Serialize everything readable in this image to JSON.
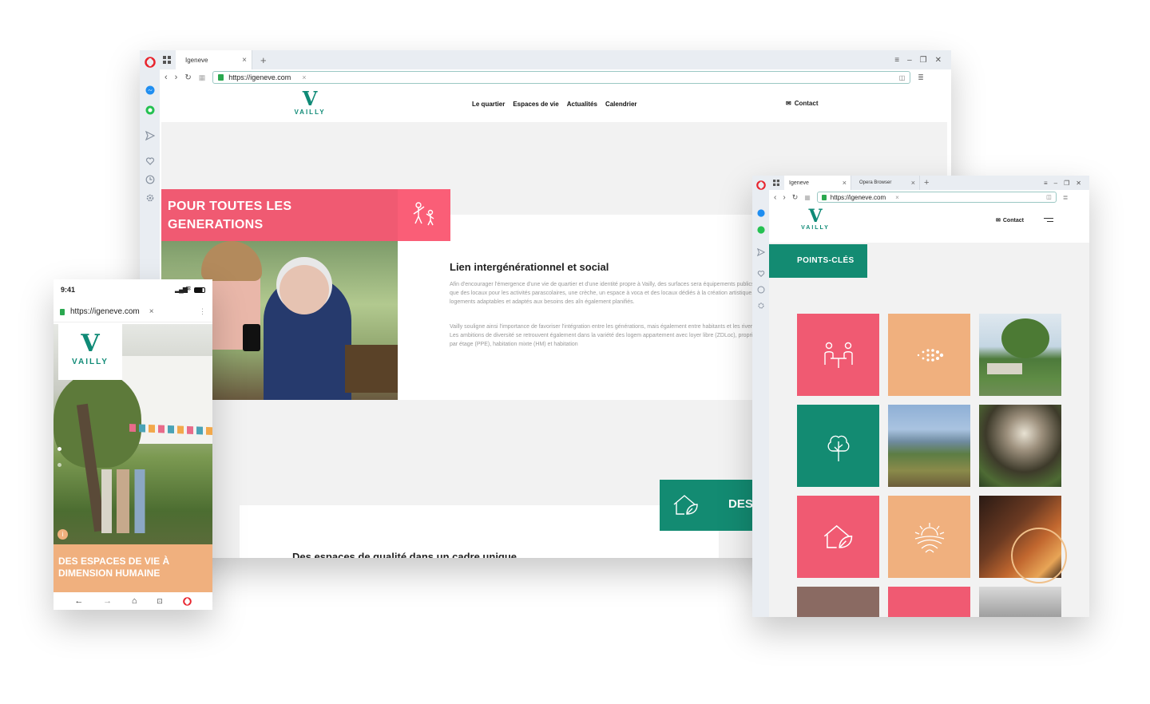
{
  "desktop": {
    "tab_title": "Igeneve",
    "url": "https://igeneve.com",
    "logo_text": "VAILLY",
    "nav": [
      "Le quartier",
      "Espaces de vie",
      "Actualités",
      "Calendrier"
    ],
    "contact": "Contact",
    "gen_banner": "POUR TOUTES LES GENERATIONS",
    "section_title": "Lien intergénérationnel et social",
    "paragraph1": "Afin d'encourager l'émergence d'une vie de quartier et d'une identité propre à Vailly, des surfaces sera équipements publics tels que des locaux pour les activités parascolaires, une crèche, un espace à voca et des locaux dédiés à la création artistique. Des logements adaptables et adaptés aux besoins des aîn également planifiés.",
    "paragraph2": "Vailly souligne ainsi l'importance de favoriser l'intégration entre les générations, mais également entre habitants et les riverains. Les ambitions de diversité se retrouvent également dans la variété des logem appartement avec loyer libre (ZDLoc), propriété par étage (PPE), habitation mixte (HM) et habitation",
    "des_label": "DES",
    "bottom_heading": "Des espaces de qualité dans un cadre unique"
  },
  "tablet": {
    "tab_title": "Igeneve",
    "tab2_title": "Opera Browser",
    "url": "https://igeneve.com",
    "logo_text": "VAILLY",
    "contact": "Contact",
    "banner": "POINTS-CLÉS"
  },
  "mobile": {
    "time": "9:41",
    "url": "https://igeneve.com",
    "logo_text": "VAILLY",
    "hero_text": "DES ESPACES DE VIE À DIMENSION HUMAINE"
  },
  "colors": {
    "teal": "#138b72",
    "pink": "#f05a72",
    "peach": "#f0b07e",
    "opera_red": "#e8242d"
  },
  "icons": [
    "opera-icon",
    "messenger-icon",
    "whatsapp-icon",
    "send-icon",
    "heart-icon",
    "history-icon",
    "settings-icon",
    "family-icon",
    "people-table-icon",
    "dots-icon",
    "tree-icon",
    "house-leaf-icon",
    "sunrise-icon",
    "envelope-icon",
    "menu-icon",
    "back-icon",
    "forward-icon",
    "home-icon",
    "tabs-icon"
  ]
}
